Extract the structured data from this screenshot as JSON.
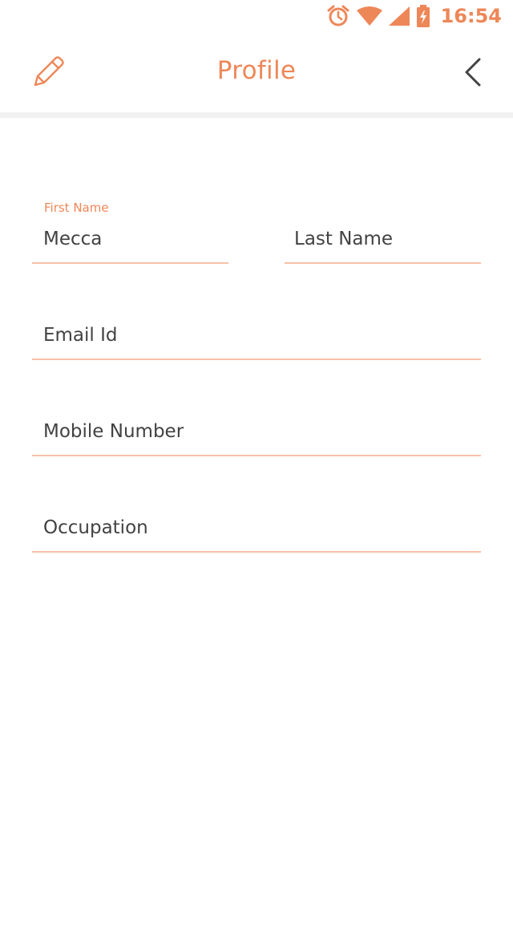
{
  "status_bar": {
    "time": "16:54",
    "icons": [
      "alarm-icon",
      "wifi-icon",
      "cell-signal-icon",
      "battery-charging-icon"
    ],
    "color": "#EE8758"
  },
  "app_bar": {
    "title": "Profile",
    "edit_icon": "pencil-icon",
    "back_icon": "chevron-left-icon"
  },
  "form": {
    "first_name": {
      "label": "First Name",
      "value": "Mecca"
    },
    "last_name": {
      "placeholder": "Last Name",
      "value": ""
    },
    "email": {
      "placeholder": "Email Id",
      "value": ""
    },
    "mobile": {
      "placeholder": "Mobile Number",
      "value": ""
    },
    "occupation": {
      "placeholder": "Occupation",
      "value": ""
    }
  },
  "colors": {
    "accent": "#EE8758",
    "underline": "#F7C0A8",
    "text": "#424242"
  }
}
